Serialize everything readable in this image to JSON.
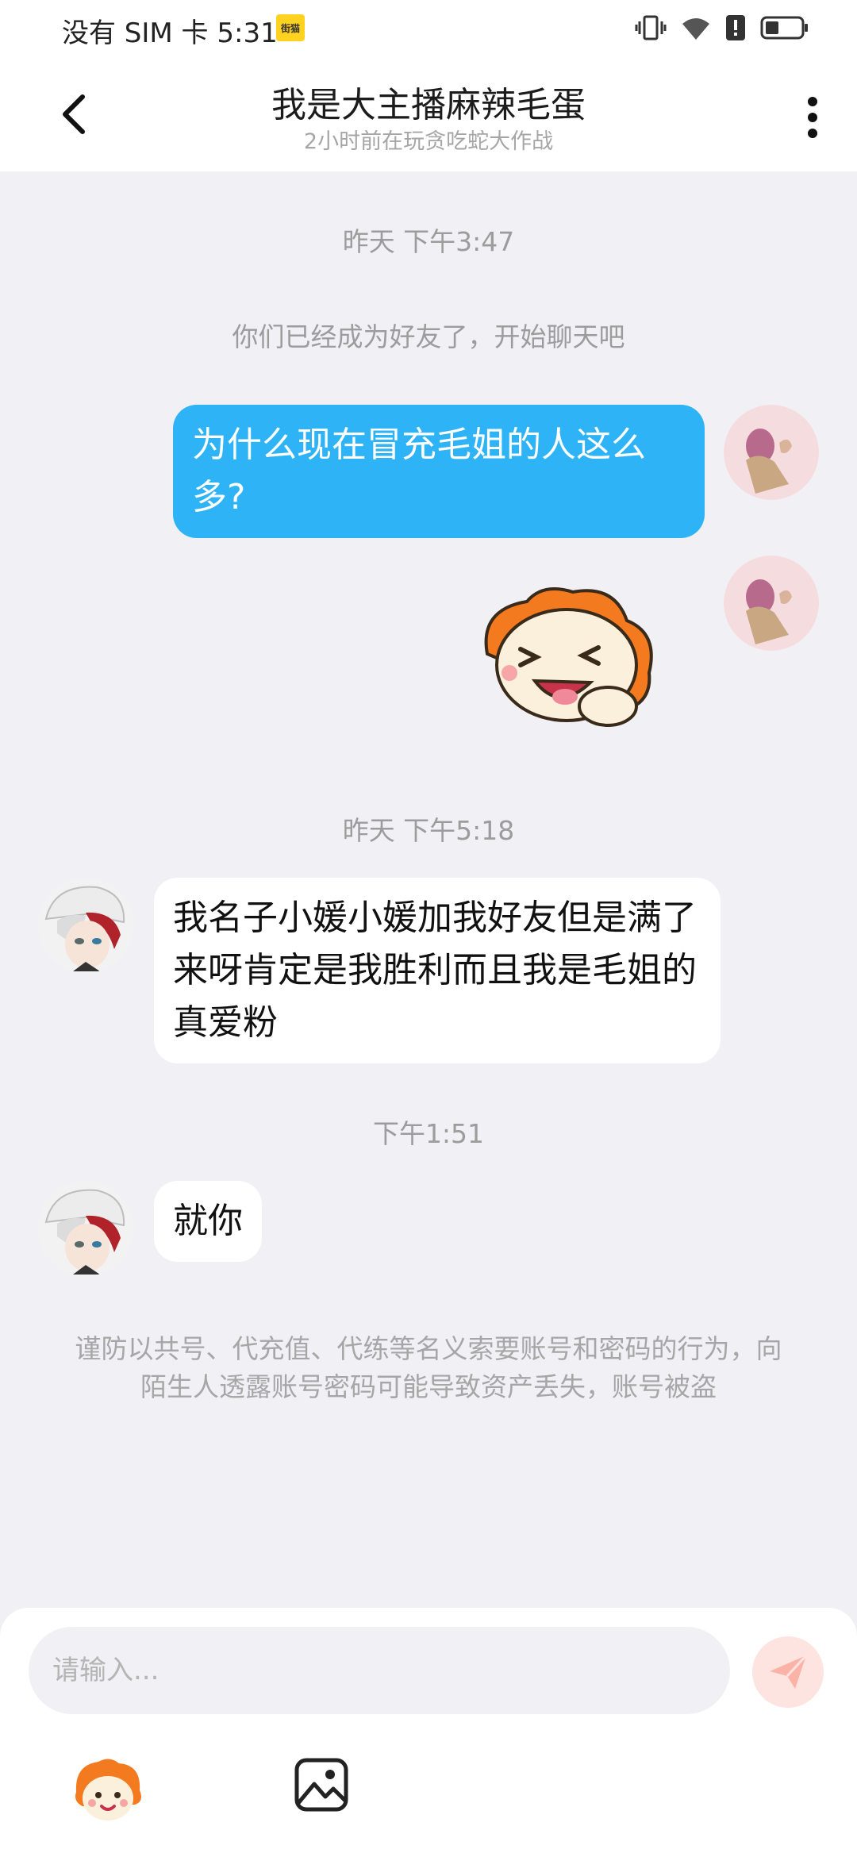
{
  "status_bar": {
    "carrier": "没有 SIM 卡 5:31",
    "app_badge": "街猫"
  },
  "header": {
    "title": "我是大主播麻辣毛蛋",
    "subtitle": "2小时前在玩贪吃蛇大作战"
  },
  "messages": {
    "ts1": "昨天 下午3:47",
    "system_notice": "你们已经成为好友了，开始聊天吧",
    "out1": "为什么现在冒充毛姐的人这么多?",
    "ts2": "昨天 下午5:18",
    "in1": "我名子小媛小媛加我好友但是满了来呀肯定是我胜利而且我是毛姐的真爱粉",
    "ts3": "下午1:51",
    "in2": "就你"
  },
  "warning": "谨防以共号、代充值、代练等名义索要账号和密码的行为，向陌生人透露账号密码可能导致资产丢失，账号被盗",
  "input": {
    "placeholder": "请输入..."
  },
  "colors": {
    "outgoing_bubble": "#2db3f6",
    "incoming_bubble": "#ffffff",
    "background": "#f1f1f5",
    "send_button": "#fde4e1",
    "sticker_orange": "#f47a1f"
  },
  "icons": [
    "back-arrow-icon",
    "more-vert-icon",
    "send-icon",
    "emoji-icon",
    "image-icon",
    "vibrate-icon",
    "wifi-icon",
    "alert-icon",
    "battery-icon"
  ]
}
